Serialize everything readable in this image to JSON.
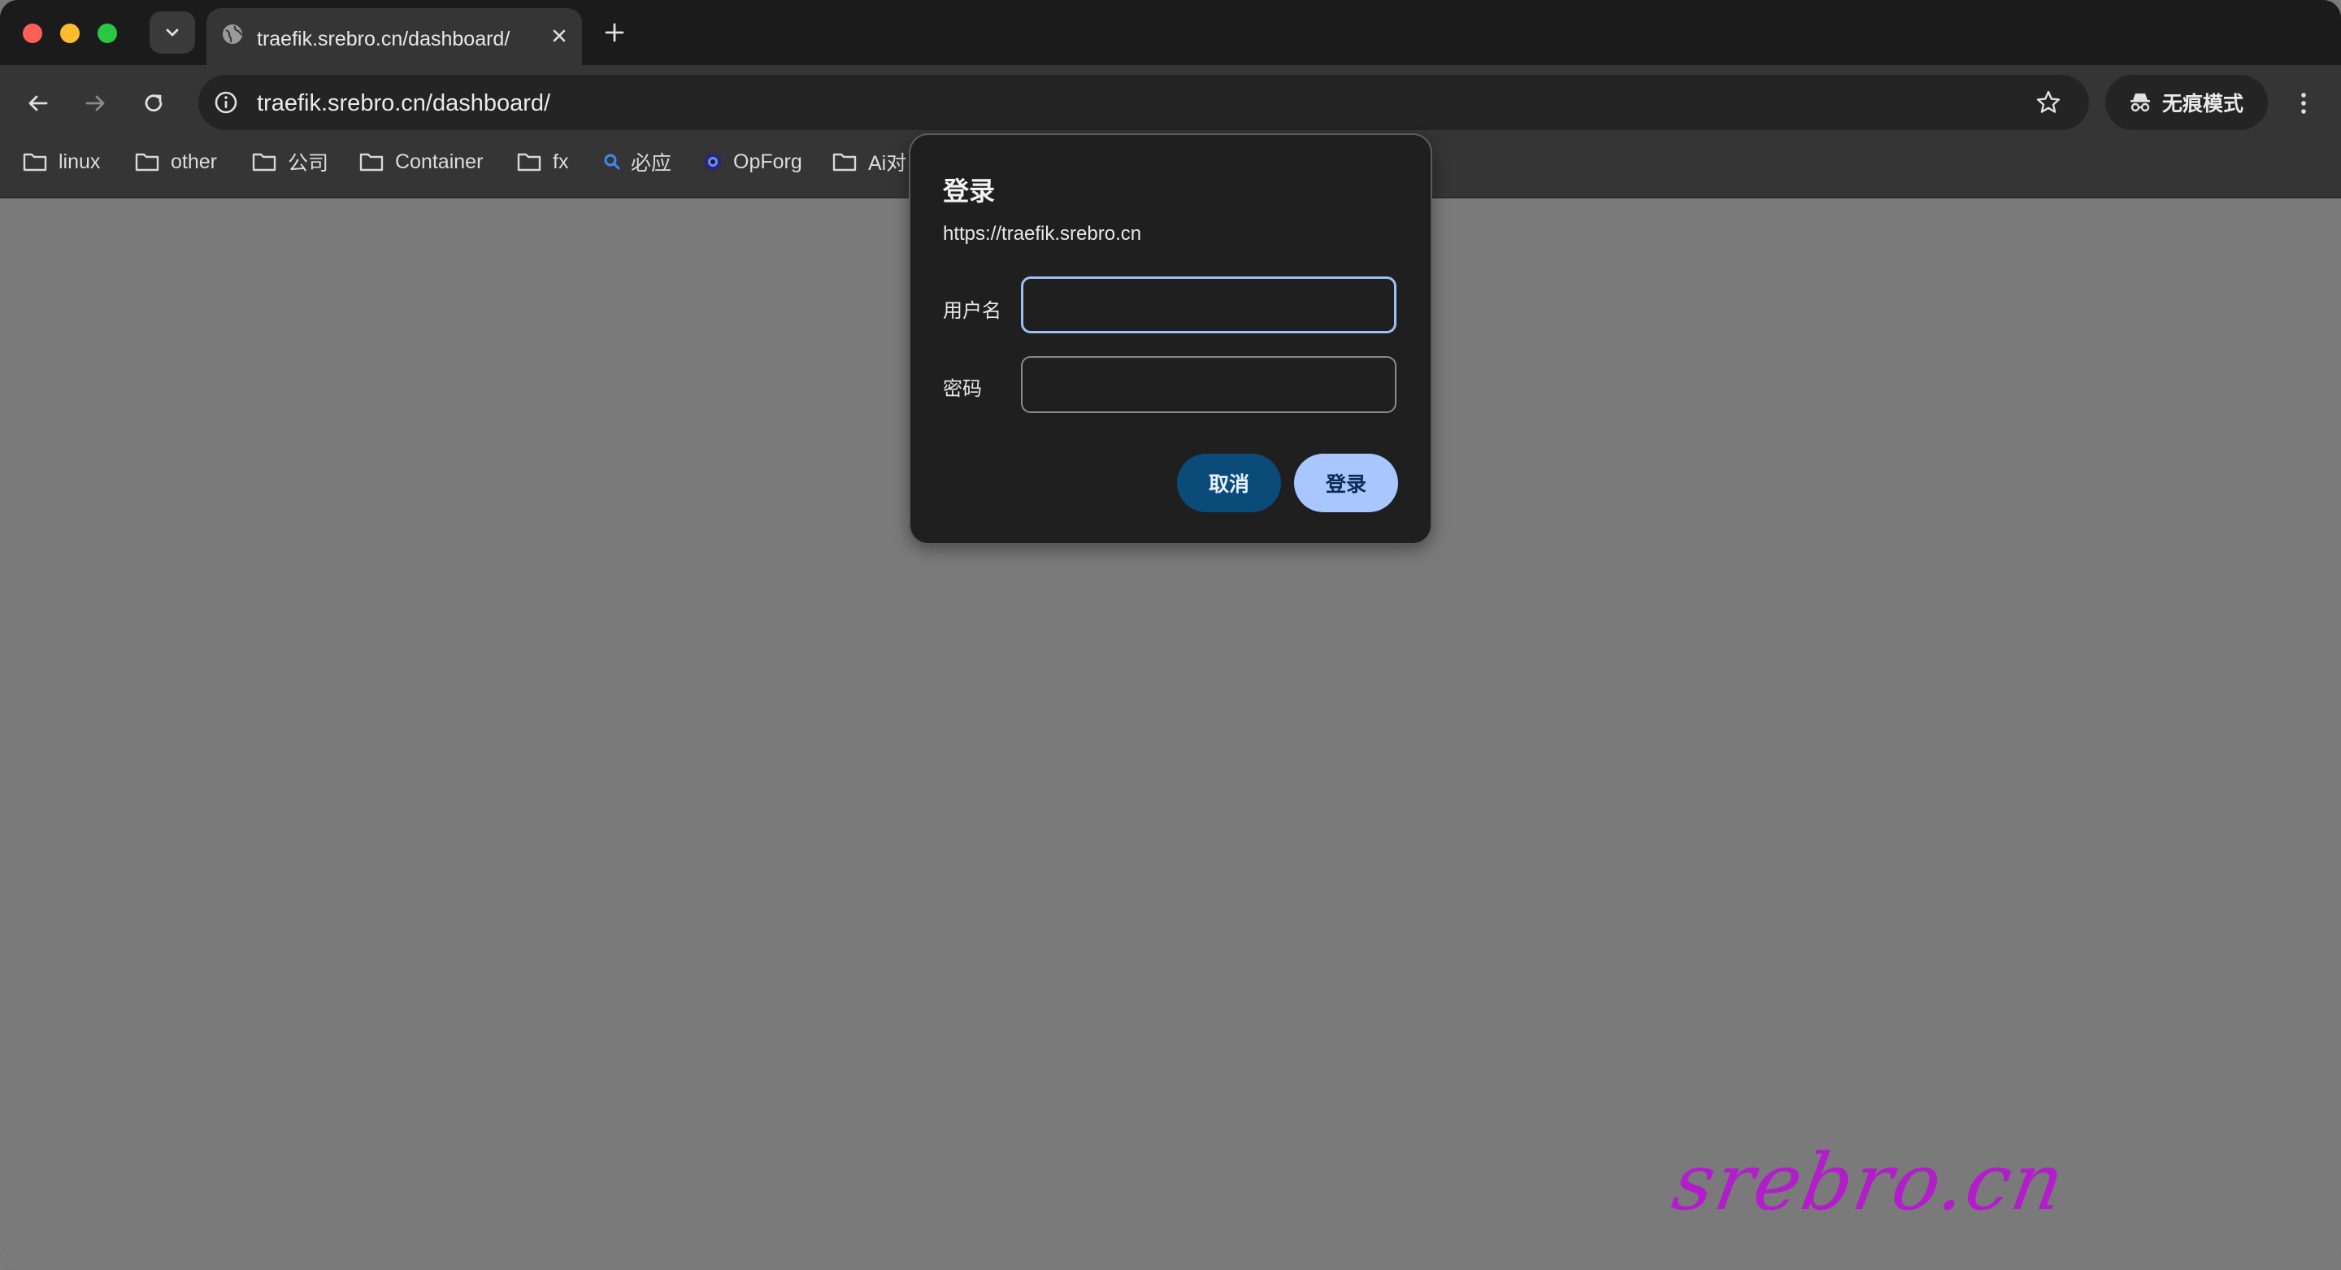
{
  "browser": {
    "tab": {
      "title": "traefik.srebro.cn/dashboard/"
    },
    "omnibox": {
      "url": "traefik.srebro.cn/dashboard/"
    },
    "incognito_label": "无痕模式",
    "bookmarks": [
      {
        "label": "linux",
        "icon": "folder-icon"
      },
      {
        "label": "other",
        "icon": "folder-icon"
      },
      {
        "label": "公司",
        "icon": "folder-icon"
      },
      {
        "label": "Container",
        "icon": "folder-icon"
      },
      {
        "label": "fx",
        "icon": "folder-icon"
      },
      {
        "label": "必应",
        "icon": "search-icon"
      },
      {
        "label": "OpForg",
        "icon": "site-icon"
      },
      {
        "label": "Ai对",
        "icon": "folder-icon"
      }
    ]
  },
  "dialog": {
    "title": "登录",
    "origin": "https://traefik.srebro.cn",
    "username_label": "用户名",
    "username_value": "",
    "password_label": "密码",
    "password_value": "",
    "cancel_label": "取消",
    "login_label": "登录"
  },
  "watermark": "srebro.cn",
  "colors": {
    "chrome_dark": "#1b1b1b",
    "toolbar": "#353535",
    "content_overlay": "#7a7a7a",
    "dialog_bg": "#1f1f1f",
    "focus_ring": "#9fbef5",
    "cancel_button": "#0b4b7a",
    "login_button": "#a8c6ff",
    "watermark": "#b31ccb"
  }
}
